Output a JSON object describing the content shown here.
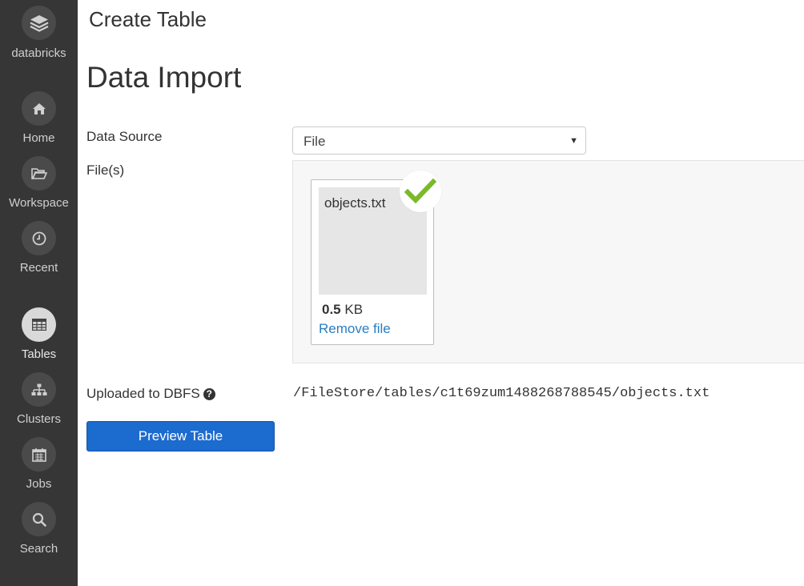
{
  "sidebar": {
    "logo_label": "databricks",
    "items": [
      {
        "label": "Home",
        "icon": "home-icon"
      },
      {
        "label": "Workspace",
        "icon": "folder-icon"
      },
      {
        "label": "Recent",
        "icon": "clock-icon"
      },
      {
        "label": "Tables",
        "icon": "table-icon",
        "active": true
      },
      {
        "label": "Clusters",
        "icon": "cluster-icon"
      },
      {
        "label": "Jobs",
        "icon": "calendar-icon"
      },
      {
        "label": "Search",
        "icon": "search-icon"
      }
    ]
  },
  "header": {
    "title": "Create Table"
  },
  "main": {
    "section_title": "Data Import",
    "data_source": {
      "label": "Data Source",
      "value": "File"
    },
    "files": {
      "label": "File(s)",
      "items": [
        {
          "name": "objects.txt",
          "size_value": "0.5",
          "size_unit": "KB",
          "remove_label": "Remove file",
          "status_icon": "checkmark-icon"
        }
      ]
    },
    "dbfs": {
      "label": "Uploaded to DBFS",
      "help_glyph": "?",
      "path": "/FileStore/tables/c1t69zum1488268788545/objects.txt"
    },
    "preview_button": "Preview Table"
  },
  "colors": {
    "sidebar_bg": "#363636",
    "primary_button": "#1c6bcf",
    "link": "#2a7dc2",
    "check": "#7ab929"
  }
}
